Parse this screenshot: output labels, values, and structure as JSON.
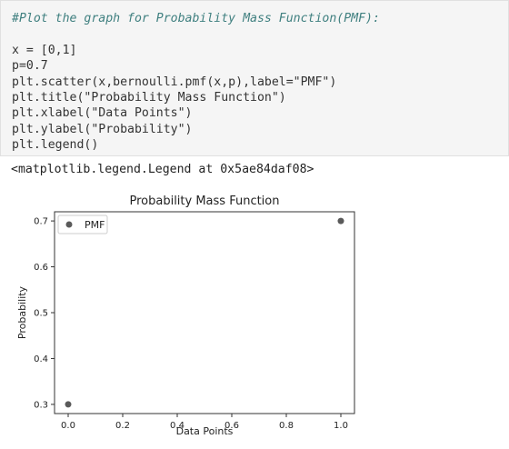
{
  "cell": {
    "code_lines": [
      "#Plot the graph for Probability Mass Function(PMF):",
      "",
      "x = [0,1]",
      "p=0.7",
      "plt.scatter(x,bernoulli.pmf(x,p),label=\"PMF\")",
      "plt.title(\"Probability Mass Function\")",
      "plt.xlabel(\"Data Points\")",
      "plt.ylabel(\"Probability\")",
      "plt.legend()"
    ]
  },
  "output": {
    "text": "<matplotlib.legend.Legend at 0x5ae84daf08>"
  },
  "chart_data": {
    "type": "scatter",
    "title": "Probability Mass Function",
    "xlabel": "Data Points",
    "ylabel": "Probability",
    "xlim": [
      -0.05,
      1.05
    ],
    "ylim": [
      0.28,
      0.72
    ],
    "xticks": [
      "0.0",
      "0.2",
      "0.4",
      "0.6",
      "0.8",
      "1.0"
    ],
    "yticks": [
      "0.3",
      "0.4",
      "0.5",
      "0.6",
      "0.7"
    ],
    "grid": false,
    "legend_position": "upper-left",
    "series": [
      {
        "name": "PMF",
        "color": "#5a5a5a",
        "x": [
          0,
          1
        ],
        "y": [
          0.3,
          0.7
        ]
      }
    ]
  }
}
